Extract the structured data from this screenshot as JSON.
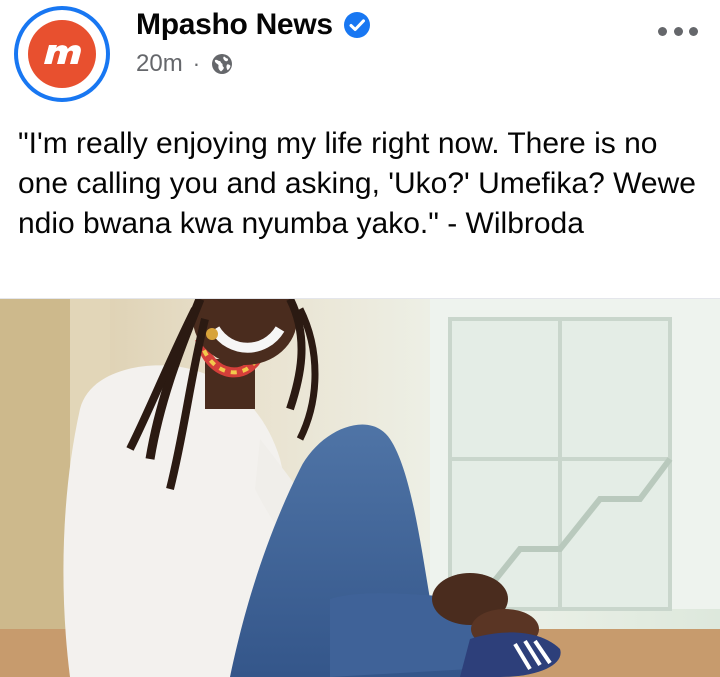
{
  "post": {
    "page_name": "Mpasho News",
    "time_ago": "20m",
    "separator": "·",
    "audience_icon": "globe-icon",
    "verified_icon": "verified-badge-icon",
    "text": "\"I'm really enjoying my life right now. There is no one calling you and asking, 'Uko?' Umefika? Wewe ndio bwana kwa nyumba yako.\" - Wilbroda"
  },
  "colors": {
    "verified_blue": "#1877f2",
    "avatar_ring": "#1877f2",
    "logo_orange": "#e8502f",
    "meta_gray": "#65676b"
  }
}
